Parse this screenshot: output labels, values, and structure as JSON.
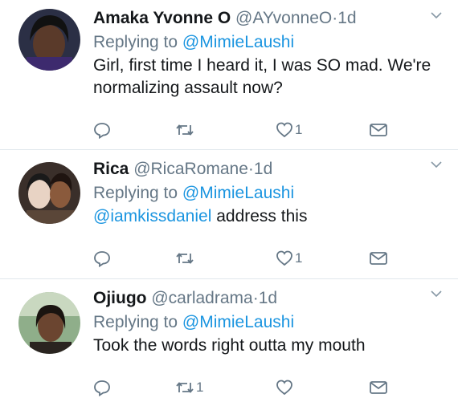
{
  "tweets": [
    {
      "name": "Amaka Yvonne O",
      "handle": "@AYvonneO",
      "time": "1d",
      "replying_prefix": "Replying to",
      "replying_to": "@MimieLaushi",
      "text": "Girl, first time I heard it, I was SO mad. We're normalizing assault now?",
      "mention_in_text": "",
      "retweets": "",
      "likes": "1"
    },
    {
      "name": "Rica",
      "handle": "@RicaRomane",
      "time": "1d",
      "replying_prefix": "Replying to",
      "replying_to": "@MimieLaushi",
      "mention_in_text": "@iamkissdaniel",
      "text": "address this",
      "retweets": "",
      "likes": "1"
    },
    {
      "name": "Ojiugo",
      "handle": "@carladrama",
      "time": "1d",
      "replying_prefix": "Replying to",
      "replying_to": "@MimieLaushi",
      "text": "Took the words right outta my mouth",
      "mention_in_text": "",
      "retweets": "1",
      "likes": ""
    }
  ],
  "separator": "·",
  "colors": {
    "accent": "#1b95e0",
    "muted": "#657786",
    "divider": "#e1e8ed"
  },
  "icons": [
    "avatar",
    "chevron-down-icon",
    "reply-icon",
    "retweet-icon",
    "like-icon",
    "direct-message-icon"
  ]
}
